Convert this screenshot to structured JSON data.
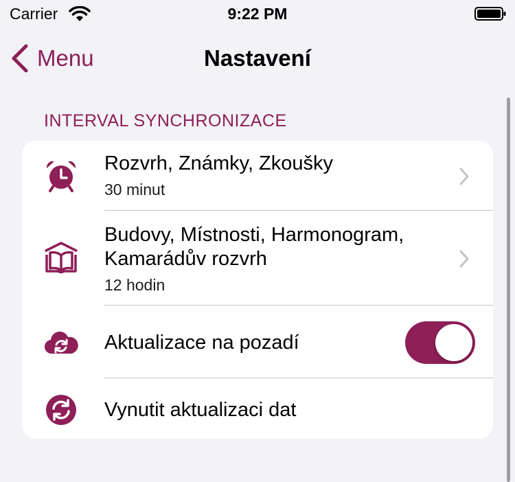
{
  "status_bar": {
    "carrier": "Carrier",
    "time": "9:22 PM"
  },
  "nav": {
    "back_label": "Menu",
    "title": "Nastavení"
  },
  "section": {
    "header": "INTERVAL SYNCHRONIZACE",
    "rows": [
      {
        "icon": "alarm-clock-icon",
        "title": "Rozvrh, Známky, Zkoušky",
        "subtitle": "30 minut"
      },
      {
        "icon": "book-icon",
        "title_line1": "Budovy, Místnosti, Harmonogram,",
        "title_line2": "Kamarádův rozvrh",
        "subtitle": "12 hodin"
      },
      {
        "icon": "cloud-sync-icon",
        "title": "Aktualizace na pozadí",
        "toggle_on": true
      },
      {
        "icon": "refresh-icon",
        "title": "Vynutit aktualizaci dat"
      }
    ]
  },
  "colors": {
    "accent": "#8e1f57",
    "background": "#f2f2f7",
    "card": "#ffffff"
  }
}
